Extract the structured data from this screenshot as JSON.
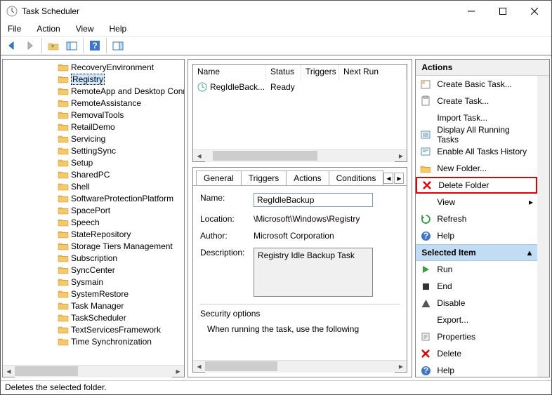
{
  "window": {
    "title": "Task Scheduler"
  },
  "menu": [
    "File",
    "Action",
    "View",
    "Help"
  ],
  "tree": {
    "selected_index": 1,
    "items": [
      "RecoveryEnvironment",
      "Registry",
      "RemoteApp and Desktop Connections",
      "RemoteAssistance",
      "RemovalTools",
      "RetailDemo",
      "Servicing",
      "SettingSync",
      "Setup",
      "SharedPC",
      "Shell",
      "SoftwareProtectionPlatform",
      "SpacePort",
      "Speech",
      "StateRepository",
      "Storage Tiers Management",
      "Subscription",
      "SyncCenter",
      "Sysmain",
      "SystemRestore",
      "Task Manager",
      "TaskScheduler",
      "TextServicesFramework",
      "Time Synchronization"
    ]
  },
  "tasklist": {
    "columns": [
      "Name",
      "Status",
      "Triggers",
      "Next Run"
    ],
    "rows": [
      {
        "name": "RegIdleBack...",
        "status": "Ready",
        "triggers": "",
        "next": ""
      }
    ]
  },
  "tabs": [
    "General",
    "Triggers",
    "Actions",
    "Conditions"
  ],
  "details": {
    "name_label": "Name:",
    "name_value": "RegIdleBackup",
    "location_label": "Location:",
    "location_value": "\\Microsoft\\Windows\\Registry",
    "author_label": "Author:",
    "author_value": "Microsoft Corporation",
    "desc_label": "Description:",
    "desc_value": "Registry Idle Backup Task",
    "sec_header": "Security options",
    "sec_line": "When running the task, use the following"
  },
  "actions": {
    "header": "Actions",
    "items_top": [
      {
        "label": "Create Basic Task...",
        "icon": "wizard"
      },
      {
        "label": "Create Task...",
        "icon": "task"
      },
      {
        "label": "Import Task...",
        "icon": "none"
      },
      {
        "label": "Display All Running Tasks",
        "icon": "list"
      },
      {
        "label": "Enable All Tasks History",
        "icon": "history"
      },
      {
        "label": "New Folder...",
        "icon": "folder"
      },
      {
        "label": "Delete Folder",
        "icon": "delete-red",
        "highlight": true
      },
      {
        "label": "View",
        "icon": "none",
        "submenu": true
      },
      {
        "label": "Refresh",
        "icon": "refresh"
      },
      {
        "label": "Help",
        "icon": "help"
      }
    ],
    "section": "Selected Item",
    "items_bottom": [
      {
        "label": "Run",
        "icon": "run"
      },
      {
        "label": "End",
        "icon": "end"
      },
      {
        "label": "Disable",
        "icon": "disable"
      },
      {
        "label": "Export...",
        "icon": "none"
      },
      {
        "label": "Properties",
        "icon": "props"
      },
      {
        "label": "Delete",
        "icon": "delete-red"
      },
      {
        "label": "Help",
        "icon": "help"
      }
    ]
  },
  "status": "Deletes the selected folder."
}
